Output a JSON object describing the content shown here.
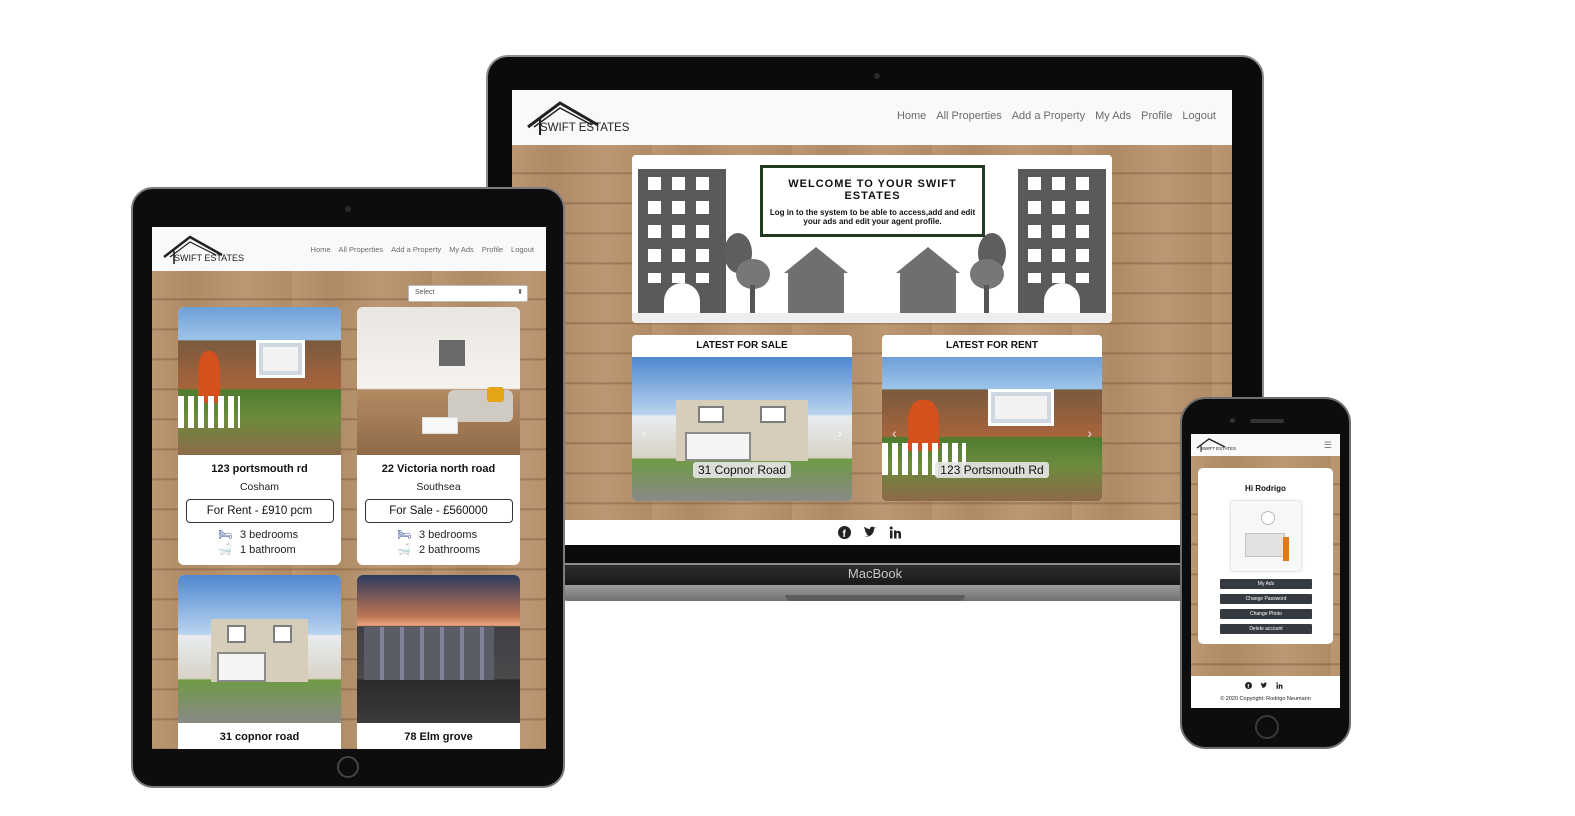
{
  "brand": {
    "name": "SWIFT ESTATES"
  },
  "nav": [
    "Home",
    "All Properties",
    "Add a Property",
    "My Ads",
    "Profile",
    "Logout"
  ],
  "laptop": {
    "device_label": "MacBook",
    "hero": {
      "title": "WELCOME TO YOUR SWIFT ESTATES",
      "subtitle": "Log in to the system to be able to access,add and edit your ads and edit your agent profile."
    },
    "latest_sale": {
      "header": "LATEST FOR SALE",
      "caption": "31 Copnor Road"
    },
    "latest_rent": {
      "header": "LATEST FOR RENT",
      "caption": "123 Portsmouth Rd"
    },
    "arrow_prev": "‹",
    "arrow_next": "›"
  },
  "tablet": {
    "select_placeholder": "Select",
    "listings": [
      {
        "address": "123 portsmouth rd",
        "area": "Cosham",
        "price": "For Rent - £910 pcm",
        "bedrooms": "3 bedrooms",
        "bathrooms": "1 bathroom"
      },
      {
        "address": "22 Victoria north road",
        "area": "Southsea",
        "price": "For Sale - £560000",
        "bedrooms": "3 bedrooms",
        "bathrooms": "2 bathrooms"
      },
      {
        "address": "31 copnor road"
      },
      {
        "address": "78 Elm grove"
      }
    ]
  },
  "phone": {
    "greeting": "Hi Rodrigo",
    "buttons": [
      "My Ads",
      "Change Password",
      "Change Photo",
      "Delete account"
    ],
    "copyright": "© 2020 Copyright: Rodrigo Neumann"
  },
  "icons": {
    "social": [
      "facebook-icon",
      "twitter-icon",
      "linkedin-icon"
    ],
    "bed": "bed-icon",
    "bath": "bath-icon"
  },
  "colors": {
    "nav_bg": "#f8f9fa",
    "wood": "#b7916a",
    "dark_button": "#343a40",
    "text": "#111111"
  }
}
